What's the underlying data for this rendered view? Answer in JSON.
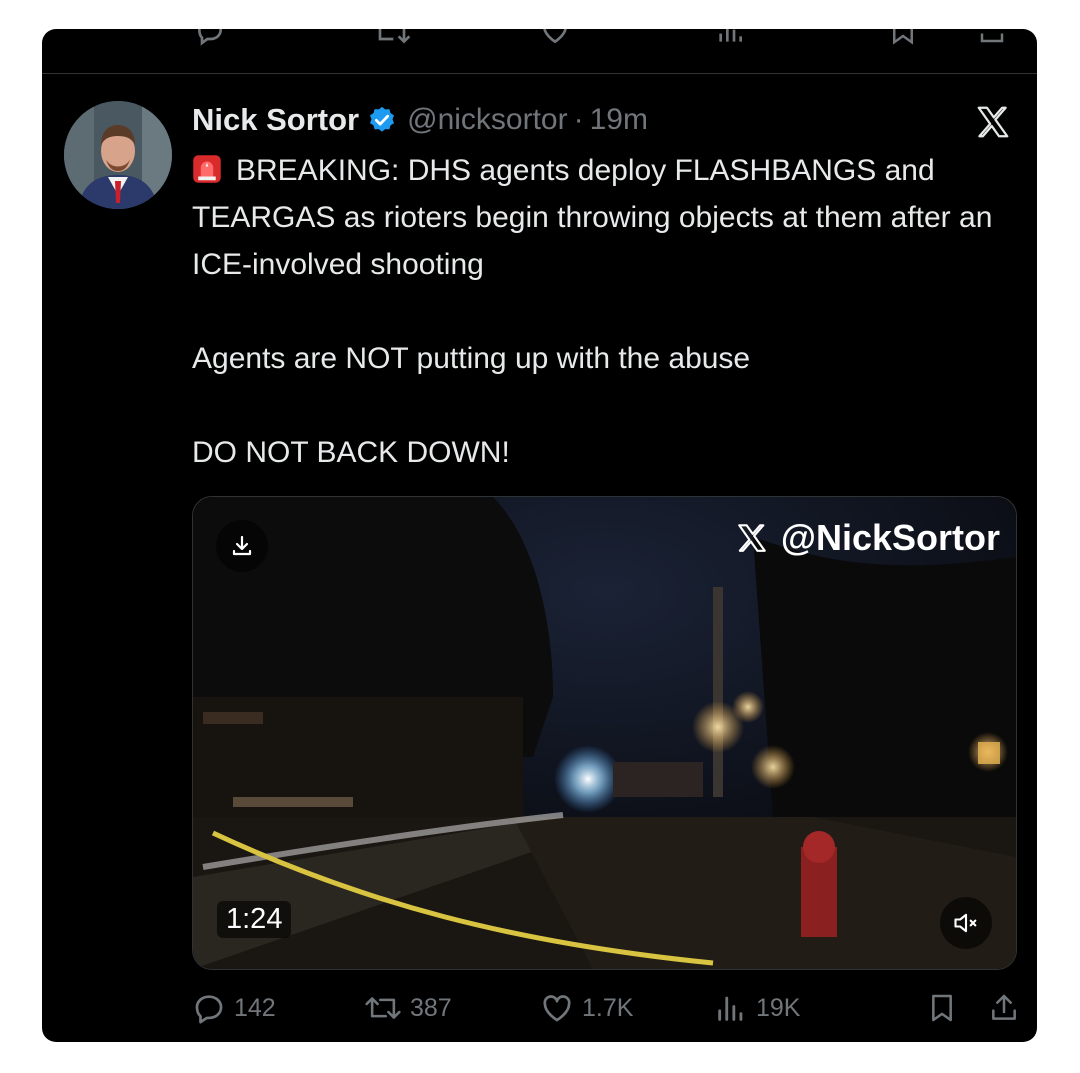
{
  "tweet": {
    "author_name": "Nick Sortor",
    "handle": "@nicksortor",
    "separator": "·",
    "time": "19m",
    "lines": [
      "BREAKING: DHS agents deploy FLASHBANGS and TEARGAS as rioters begin throwing objects at them after an ICE-involved shooting",
      "Agents are NOT putting up with the abuse",
      "DO NOT BACK DOWN!"
    ],
    "emoji_icon": "police-siren-icon",
    "verified_icon": "verified-badge-icon",
    "platform_icon": "x-logo-icon"
  },
  "media": {
    "watermark": "@NickSortor",
    "duration": "1:24",
    "download_icon": "download-icon",
    "mute_icon": "muted-speaker-icon"
  },
  "actions": {
    "replies": "142",
    "reposts": "387",
    "likes": "1.7K",
    "views": "19K"
  },
  "colors": {
    "background": "#000000",
    "text": "#e7e9ea",
    "muted": "#71767b",
    "verified": "#1d9bf0"
  }
}
